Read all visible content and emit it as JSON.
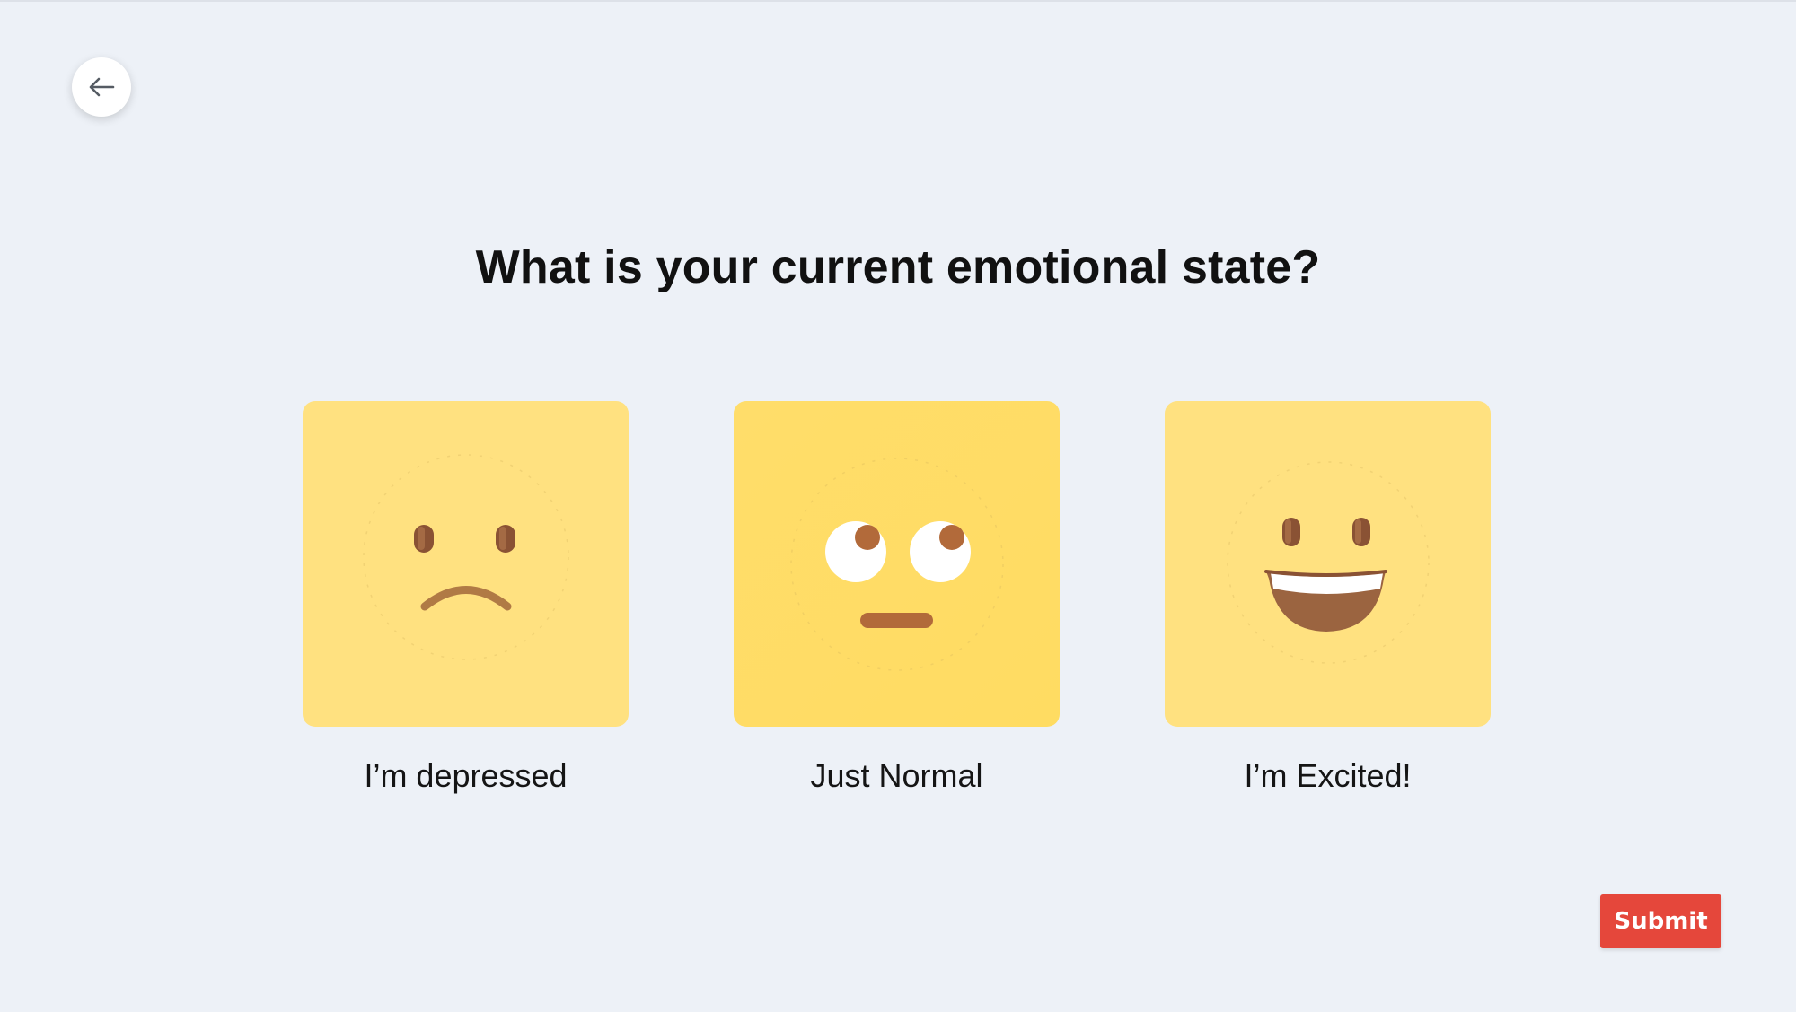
{
  "header": {
    "back_icon": "arrow-left-icon"
  },
  "question": {
    "title": "What is your current emotional state?"
  },
  "options": [
    {
      "label": "I’m depressed",
      "icon": "sad-face-icon"
    },
    {
      "label": "Just Normal",
      "icon": "eye-roll-face-icon"
    },
    {
      "label": "I’m Excited!",
      "icon": "grinning-face-icon"
    }
  ],
  "actions": {
    "submit_label": "Submit"
  },
  "colors": {
    "background": "#edf1f7",
    "card": "#ffe180",
    "submit": "#e5473b",
    "title": "#111111"
  }
}
